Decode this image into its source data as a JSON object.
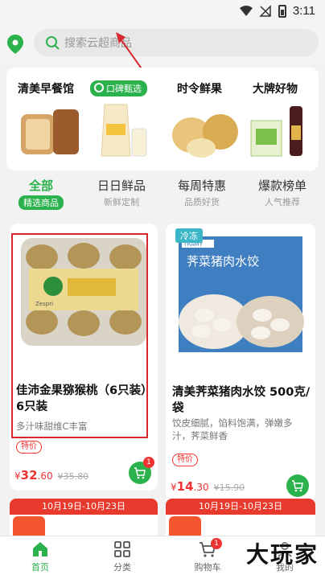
{
  "status_bar": {
    "time": "3:11"
  },
  "search": {
    "placeholder": "搜索云超商品"
  },
  "categories": [
    {
      "title": "清美早餐馆"
    },
    {
      "title": "时令鲜果"
    },
    {
      "title": "大牌好物"
    }
  ],
  "category_badge": "口碑甄选",
  "tabs": [
    {
      "label": "全部",
      "sublabel": "精选商品",
      "active": true
    },
    {
      "label": "日日鲜品",
      "sublabel": "新鲜定制",
      "active": false
    },
    {
      "label": "每周特惠",
      "sublabel": "品质好货",
      "active": false
    },
    {
      "label": "爆款榜单",
      "sublabel": "人气推荐",
      "active": false
    }
  ],
  "products": [
    {
      "title": "佳沛金果猕猴桃（6只装）6只装",
      "description": "多汁味甜维C丰富",
      "tag": "特价",
      "price_int": "32",
      "price_dec": ".60",
      "original_price": "¥35.80",
      "cart_badge": "1",
      "package_label": "Zespri"
    },
    {
      "title": "清美荠菜猪肉水饺 500克/袋",
      "description": "饺皮细腻，馅料饱满，弹嫩多汁，荠菜鲜香",
      "tag": "特价",
      "price_int": "14",
      "price_dec": ".30",
      "original_price": "¥15.90",
      "corner_tag": "冷冻",
      "package_text": "荠菜猪肉水饺",
      "package_brand": "TRAMY"
    }
  ],
  "promos": [
    {
      "date": "10月19日-10月23日"
    },
    {
      "date": "10月19日-10月23日"
    }
  ],
  "bottom_nav": [
    {
      "label": "首页",
      "active": true
    },
    {
      "label": "分类",
      "active": false
    },
    {
      "label": "购物车",
      "active": false,
      "badge": "1"
    },
    {
      "label": "我的",
      "active": false
    }
  ],
  "watermark": "大玩家",
  "colors": {
    "accent": "#2bb24c",
    "price": "#e33333",
    "annotation": "#d8282f"
  }
}
